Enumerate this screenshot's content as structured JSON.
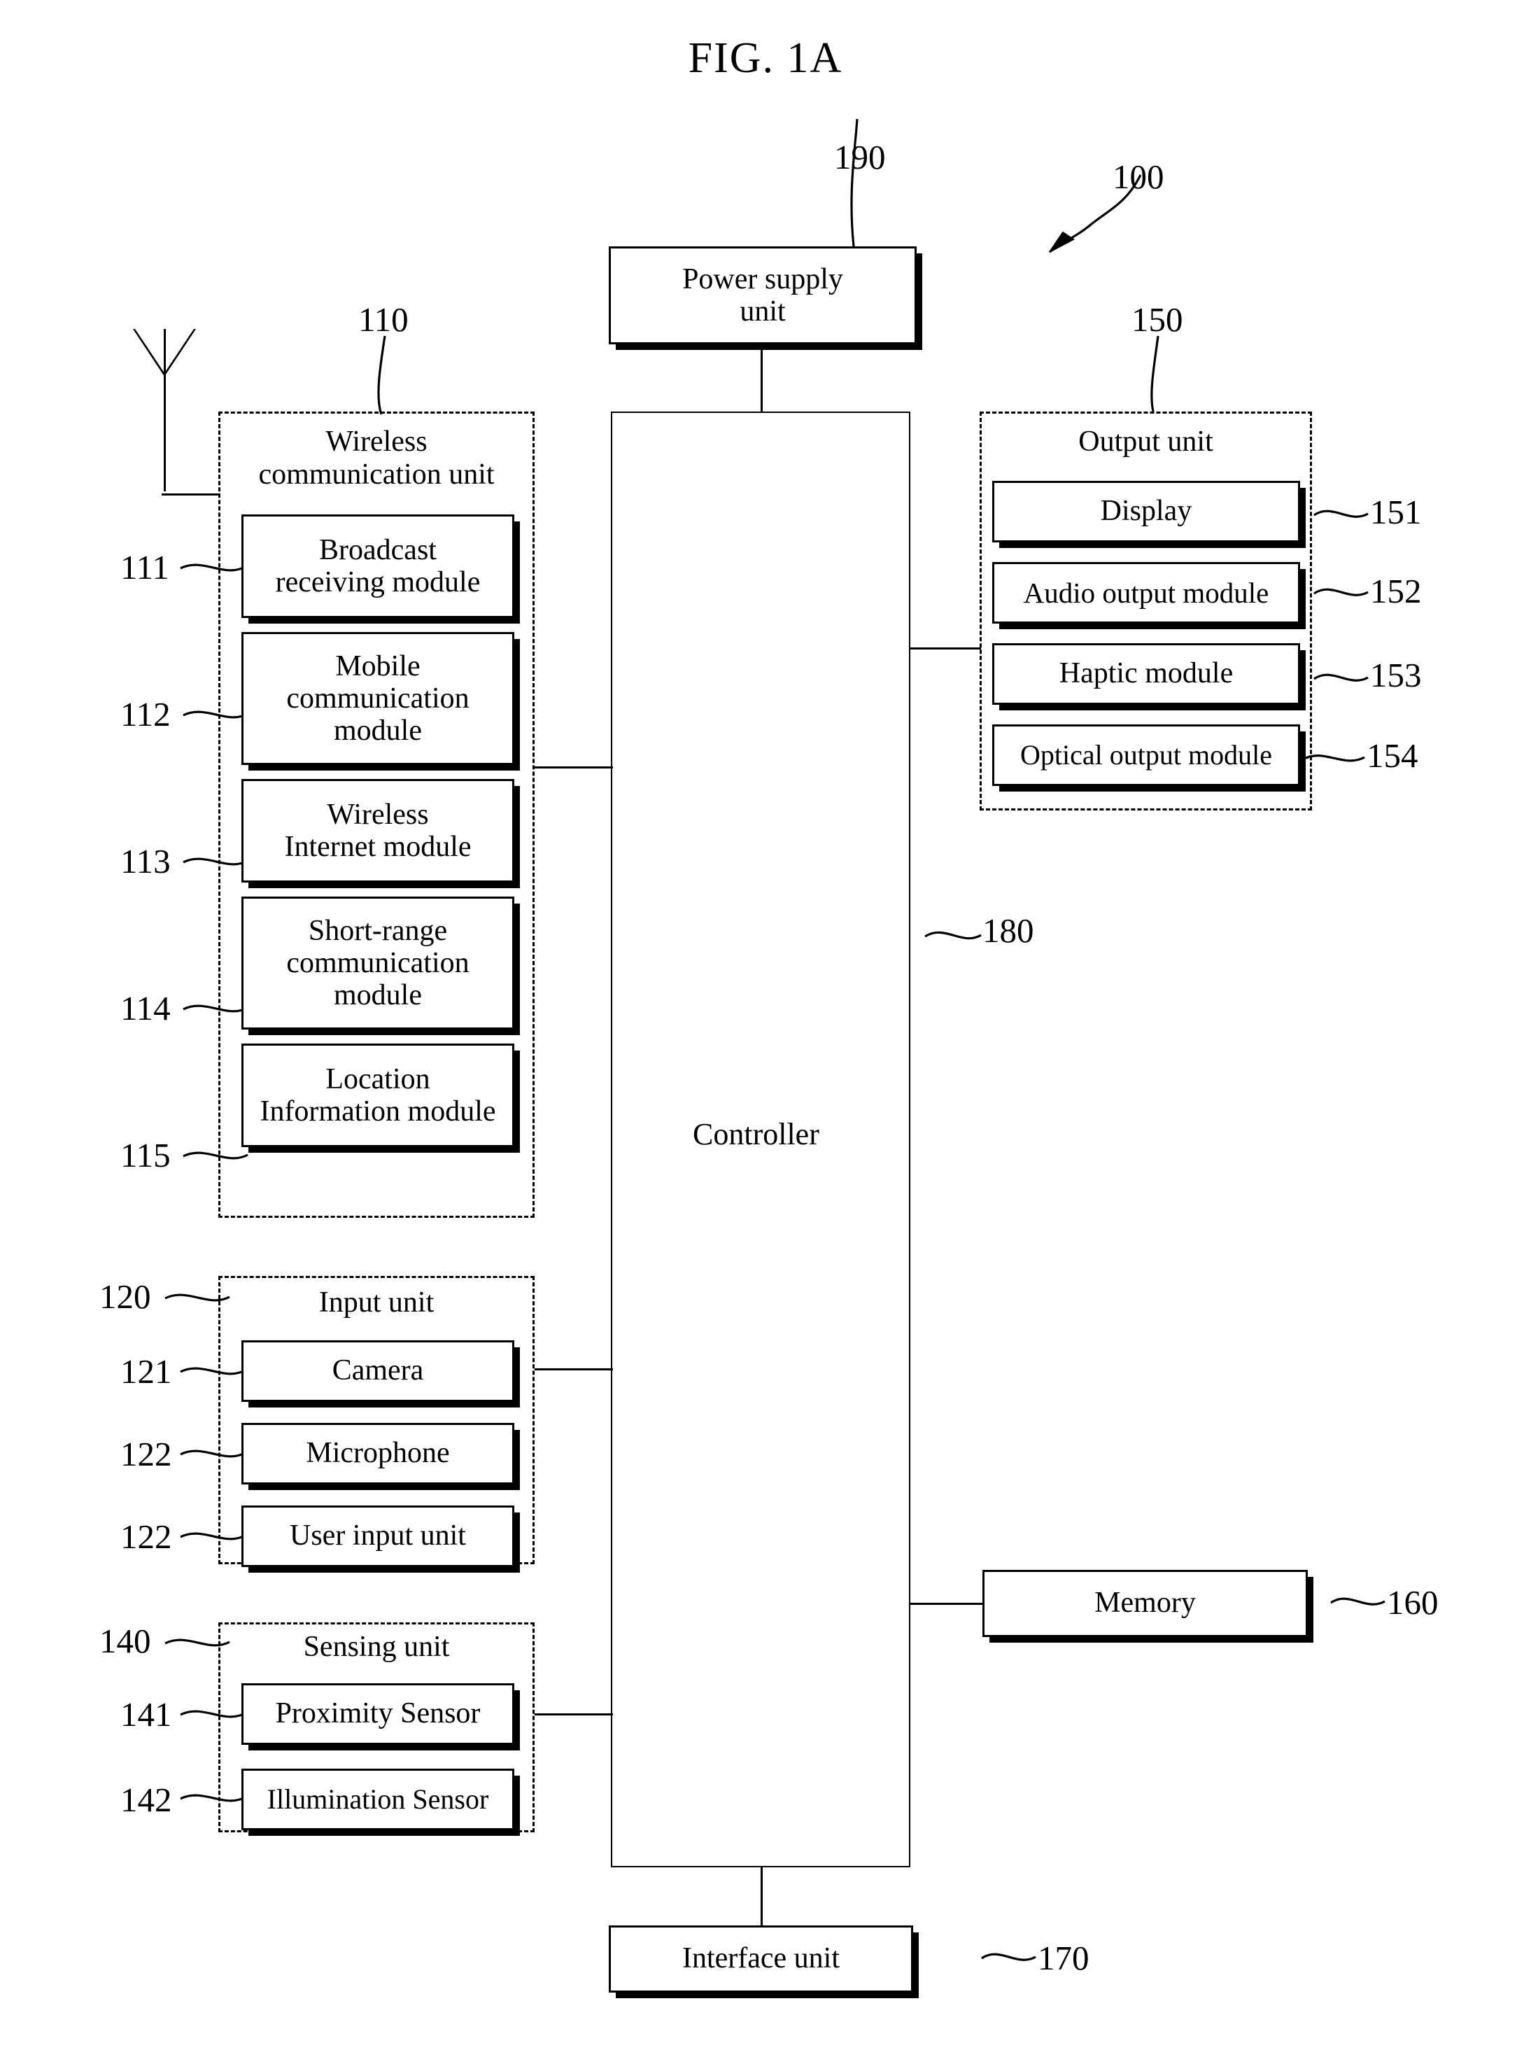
{
  "figure": {
    "title": "FIG.  1A",
    "device_ref": "100"
  },
  "power_supply": {
    "label": "Power supply unit",
    "line1": "Power supply",
    "line2": "unit",
    "ref": "190"
  },
  "controller": {
    "label": "Controller",
    "ref": "180"
  },
  "wireless_unit": {
    "ref": "110",
    "title_line1": "Wireless",
    "title_line2": "communication unit",
    "modules": [
      {
        "ref": "111",
        "line1": "Broadcast",
        "line2": "receiving module",
        "line3": ""
      },
      {
        "ref": "112",
        "line1": "Mobile",
        "line2": "communication",
        "line3": "module"
      },
      {
        "ref": "113",
        "line1": "Wireless",
        "line2": "Internet module",
        "line3": ""
      },
      {
        "ref": "114",
        "line1": "Short-range",
        "line2": "communication",
        "line3": "module"
      },
      {
        "ref": "115",
        "line1": "Location",
        "line2": "Information module",
        "line3": ""
      }
    ]
  },
  "input_unit": {
    "ref": "120",
    "title": "Input unit",
    "modules": [
      {
        "ref": "121",
        "label": "Camera"
      },
      {
        "ref": "122",
        "label": "Microphone"
      },
      {
        "ref": "122",
        "label": "User input unit"
      }
    ]
  },
  "sensing_unit": {
    "ref": "140",
    "title": "Sensing unit",
    "modules": [
      {
        "ref": "141",
        "label": "Proximity Sensor"
      },
      {
        "ref": "142",
        "label": "Illumination Sensor"
      }
    ]
  },
  "output_unit": {
    "ref": "150",
    "title": "Output unit",
    "modules": [
      {
        "ref": "151",
        "label": "Display"
      },
      {
        "ref": "152",
        "label": "Audio output module"
      },
      {
        "ref": "153",
        "label": "Haptic module"
      },
      {
        "ref": "154",
        "label": "Optical output module"
      }
    ]
  },
  "memory": {
    "label": "Memory",
    "ref": "160"
  },
  "interface_unit": {
    "label": "Interface unit",
    "ref": "170"
  },
  "antenna": {
    "name": "antenna-symbol"
  },
  "colors": {
    "ink": "#000000",
    "paper": "#ffffff"
  }
}
